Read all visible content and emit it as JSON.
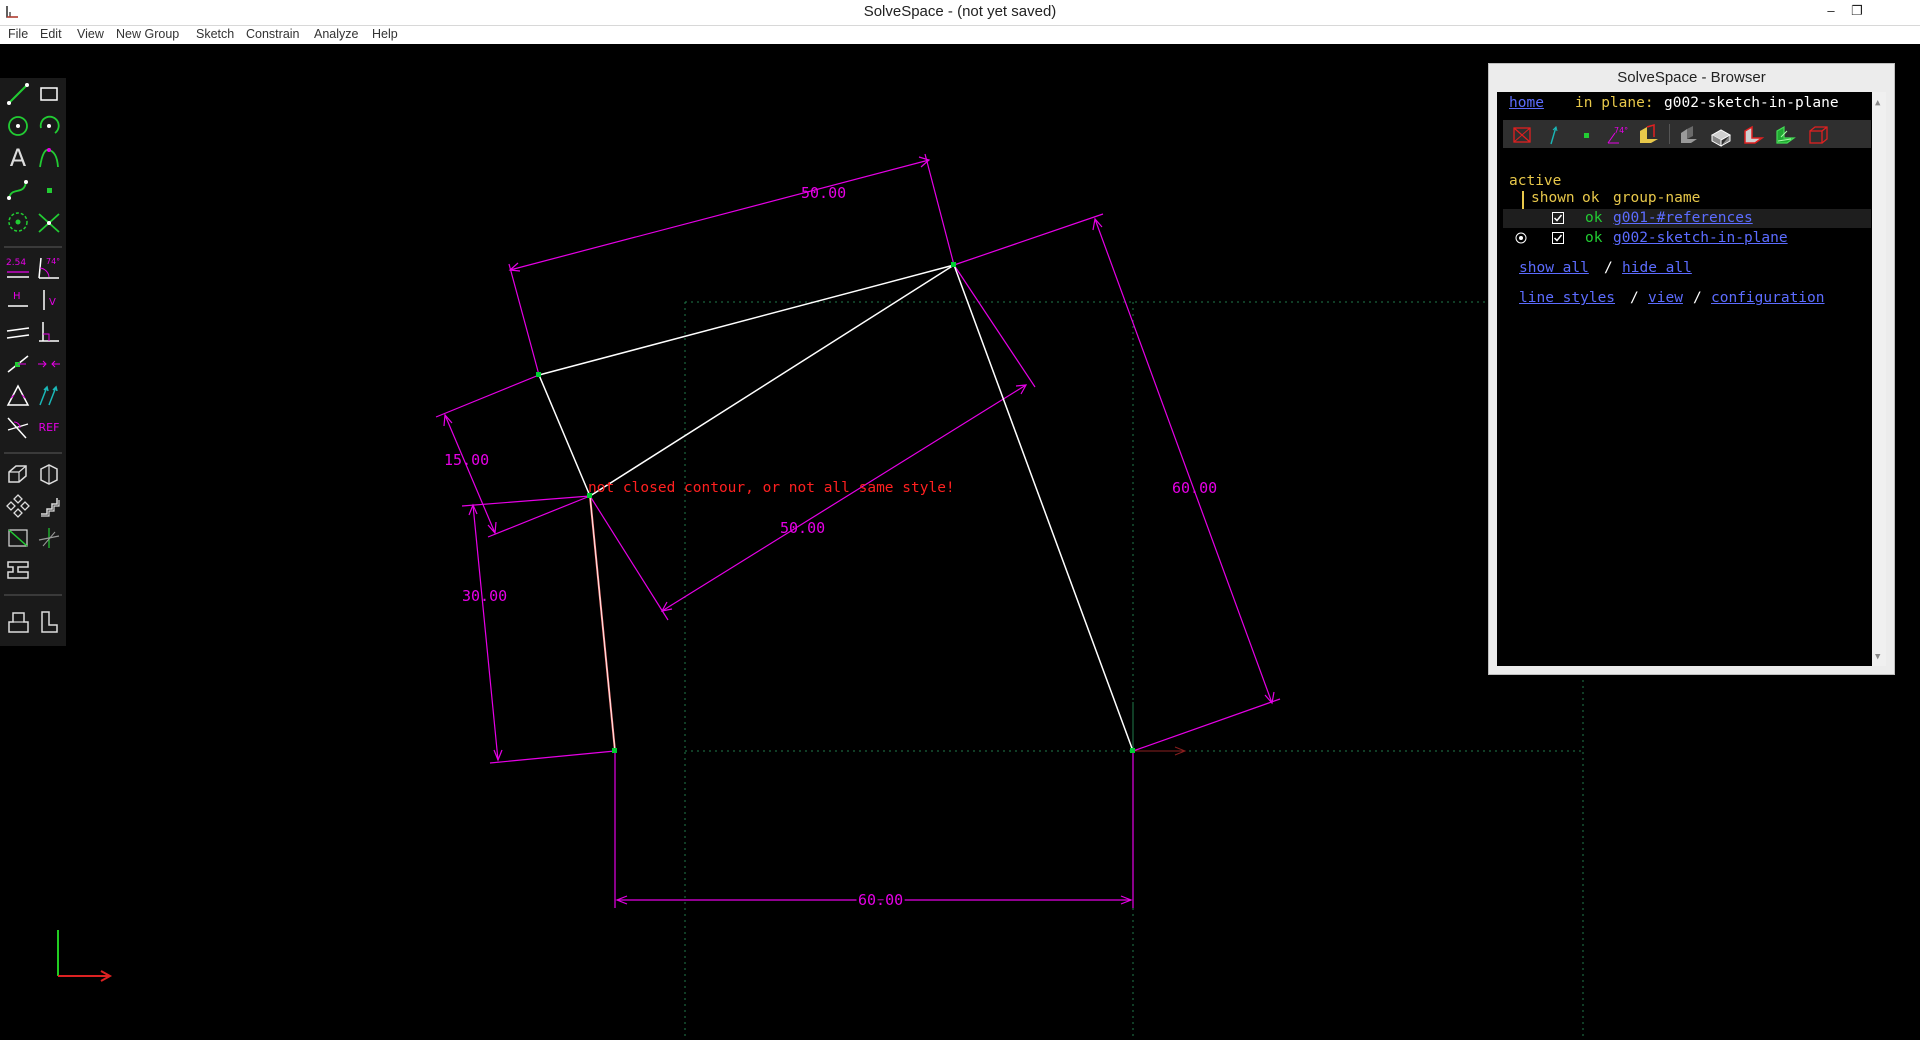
{
  "window": {
    "title": "SolveSpace - (not yet saved)",
    "minimize": "–",
    "restore": "❐"
  },
  "menu": {
    "items": [
      "File",
      "Edit",
      "View",
      "New Group",
      "Sketch",
      "Constrain",
      "Analyze",
      "Help"
    ]
  },
  "toolbar": {
    "tools": [
      {
        "name": "line",
        "label": ""
      },
      {
        "name": "rectangle",
        "label": ""
      },
      {
        "name": "circle",
        "label": ""
      },
      {
        "name": "arc",
        "label": ""
      },
      {
        "name": "text",
        "label": "A"
      },
      {
        "name": "tangent-arc",
        "label": ""
      },
      {
        "name": "bezier",
        "label": ""
      },
      {
        "name": "point",
        "label": ""
      },
      {
        "name": "construction",
        "label": ""
      },
      {
        "name": "split",
        "label": ""
      },
      {
        "name": "distance-dimension",
        "label": "2.54"
      },
      {
        "name": "angle-dimension",
        "label": "74°"
      },
      {
        "name": "horizontal",
        "label": "H"
      },
      {
        "name": "vertical",
        "label": "V"
      },
      {
        "name": "parallel",
        "label": ""
      },
      {
        "name": "perpendicular",
        "label": ""
      },
      {
        "name": "point-on-entity",
        "label": ""
      },
      {
        "name": "symmetric",
        "label": ""
      },
      {
        "name": "equal",
        "label": ""
      },
      {
        "name": "same-orientation",
        "label": ""
      },
      {
        "name": "other-supplementary",
        "label": ""
      },
      {
        "name": "reference",
        "label": "REF"
      },
      {
        "name": "step-translate",
        "label": ""
      },
      {
        "name": "step-rotate",
        "label": ""
      },
      {
        "name": "extrude",
        "label": ""
      },
      {
        "name": "lathe",
        "label": ""
      },
      {
        "name": "workplane",
        "label": ""
      },
      {
        "name": "sketch-3d",
        "label": ""
      },
      {
        "name": "import",
        "label": ""
      },
      {
        "name": "assemble",
        "label": ""
      },
      {
        "name": "nearest-iso",
        "label": ""
      }
    ]
  },
  "sketch": {
    "dimensions": [
      "50.00",
      "60.00",
      "15.00",
      "30.00",
      "50.00",
      "60.00"
    ],
    "error": "not closed contour, or not all same style!"
  },
  "browser": {
    "title": "SolveSpace - Browser",
    "nav_home": "home",
    "nav_in_plane": "in plane:",
    "nav_plane_name": "g002-sketch-in-plane",
    "active_label": "active",
    "columns": {
      "shown": "shown",
      "ok": "ok",
      "group_name": "group-name"
    },
    "groups": [
      {
        "ok": "ok",
        "name": "g001-#references",
        "active": false
      },
      {
        "ok": "ok",
        "name": "g002-sketch-in-plane",
        "active": true
      }
    ],
    "show_all": "show all",
    "sep1": "/",
    "hide_all": "hide all",
    "line_styles": "line styles",
    "sep2": "/",
    "view": "view",
    "sep3": "/",
    "configuration": "configuration",
    "display_icons": [
      "workplane-icon",
      "normal-icon",
      "point-icon",
      "angle-icon",
      "faces-icon",
      "solid-icon",
      "shaded-icon",
      "outline-icon",
      "mesh-icon",
      "hidden-lines-icon"
    ]
  },
  "colors": {
    "background": "#000000",
    "dimension": "#e600e6",
    "geometry": "#ffffff",
    "error": "#ff2020",
    "point": "#00cc33",
    "link": "#5c6cff",
    "label": "#e8c84a"
  }
}
